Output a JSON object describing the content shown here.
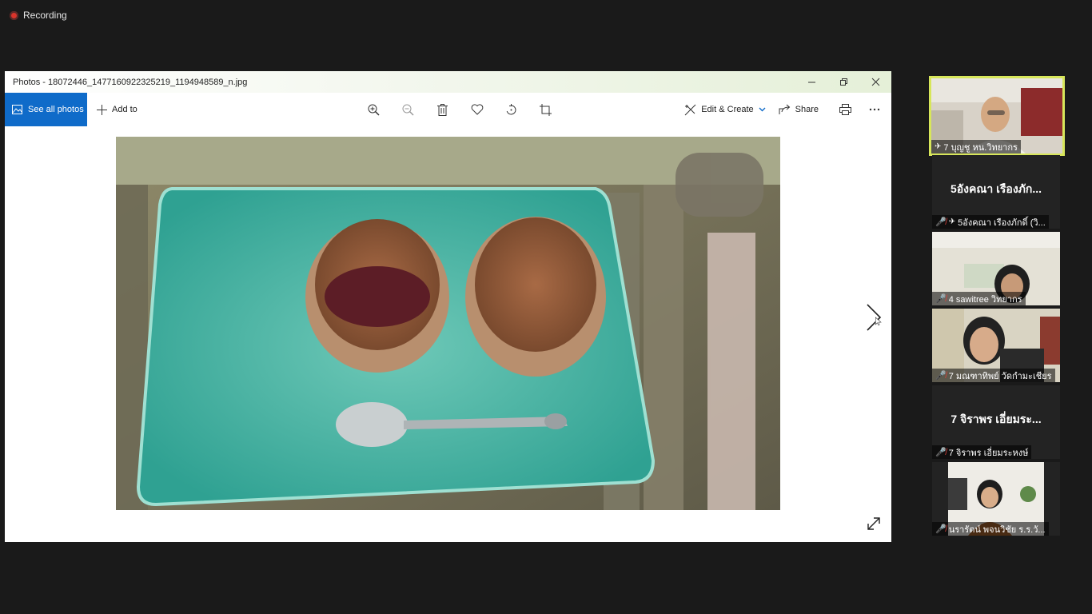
{
  "recording": {
    "label": "Recording"
  },
  "window": {
    "title": "Photos - 18072446_1477160922325219_1194948589_n.jpg",
    "controls": {
      "minimize": "—",
      "restore": "❐",
      "close": "✕"
    }
  },
  "toolbar": {
    "see_all_label": "See all photos",
    "add_to_label": "Add to",
    "edit_create_label": "Edit & Create",
    "share_label": "Share"
  },
  "photo": {
    "description_icons": [
      "zoom-in-icon",
      "zoom-out-icon",
      "delete-icon",
      "favorite-icon",
      "rotate-icon",
      "crop-icon"
    ]
  },
  "participants": [
    {
      "name": "7 บุญชู หน.วิทยากร",
      "big": "",
      "pinned": true,
      "muted": false,
      "active": true
    },
    {
      "name": "5อังคณา เรืองภักดิ์ (วิ...",
      "big": "5อังคณา เรืองภัก...",
      "pinned": true,
      "muted": true,
      "active": false
    },
    {
      "name": "4 sawitree วิทยากร",
      "big": "",
      "pinned": false,
      "muted": true,
      "active": false
    },
    {
      "name": "7 มณฑาทิพย์ วัดกำมะเชียร",
      "big": "",
      "pinned": false,
      "muted": true,
      "active": false
    },
    {
      "name": "7 จิราพร เอี่ยมระหงษ์",
      "big": "7 จิราพร เอี่ยมระ...",
      "pinned": false,
      "muted": true,
      "active": false
    },
    {
      "name": "นรารัตน์ พจนวิชัย ร.ร.วั...",
      "big": "",
      "pinned": false,
      "muted": true,
      "active": false
    }
  ],
  "colors": {
    "accent": "#0f6bc9",
    "active_speaker": "#d7e65a",
    "mic_muted": "#e0413a"
  }
}
